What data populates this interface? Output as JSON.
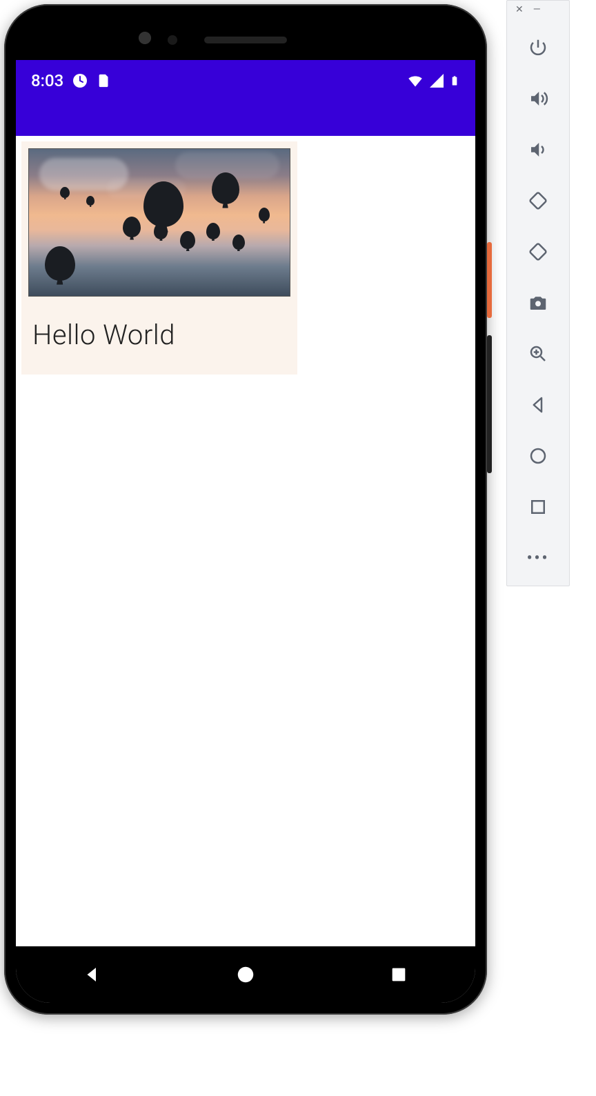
{
  "status_bar": {
    "time": "8:03",
    "icons_left": [
      "clock-app-icon",
      "sim-card-icon"
    ],
    "icons_right": [
      "wifi-icon",
      "cell-signal-icon",
      "battery-icon"
    ]
  },
  "card": {
    "title": "Hello World",
    "image_alt": "hot-air-balloons-sunset"
  },
  "nav": {
    "back": "back-icon",
    "home": "home-icon",
    "recents": "recents-icon"
  },
  "emulator_toolbar": {
    "window_controls": [
      "close",
      "minimize"
    ],
    "buttons": [
      {
        "name": "power-icon",
        "label": "Power"
      },
      {
        "name": "volume-up-icon",
        "label": "Volume Up"
      },
      {
        "name": "volume-down-icon",
        "label": "Volume Down"
      },
      {
        "name": "rotate-left-icon",
        "label": "Rotate Left"
      },
      {
        "name": "rotate-right-icon",
        "label": "Rotate Right"
      },
      {
        "name": "screenshot-icon",
        "label": "Take Screenshot"
      },
      {
        "name": "zoom-in-icon",
        "label": "Zoom"
      },
      {
        "name": "back-icon",
        "label": "Back"
      },
      {
        "name": "home-icon",
        "label": "Home"
      },
      {
        "name": "overview-icon",
        "label": "Overview"
      }
    ],
    "more": "•••"
  },
  "colors": {
    "status_bar_bg": "#3700D8",
    "card_bg": "#FBF3EC"
  }
}
